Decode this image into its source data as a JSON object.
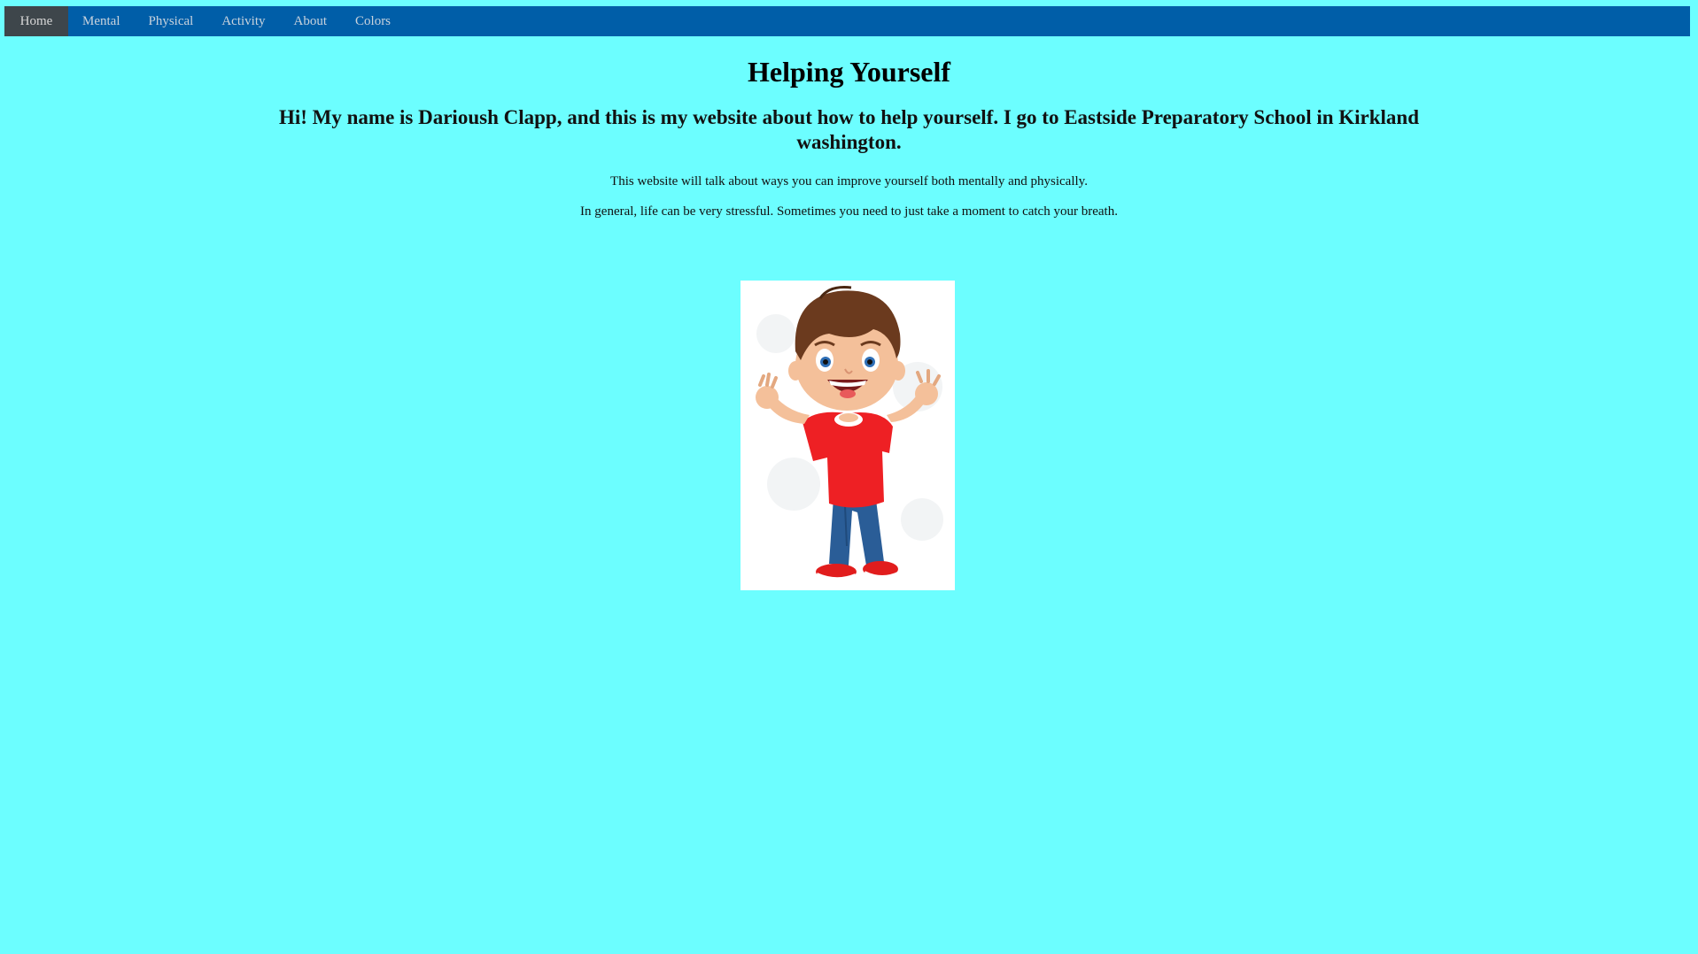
{
  "nav": {
    "items": [
      {
        "label": "Home",
        "active": true
      },
      {
        "label": "Mental",
        "active": false
      },
      {
        "label": "Physical",
        "active": false
      },
      {
        "label": "Activity",
        "active": false
      },
      {
        "label": "About",
        "active": false
      },
      {
        "label": "Colors",
        "active": false
      }
    ]
  },
  "main": {
    "title": "Helping Yourself",
    "intro": "Hi! My name is Darioush Clapp, and this is my website about how to help yourself. I go to Eastside Preparatory School in Kirkland washington.",
    "paragraphs": [
      "This website will talk about ways you can improve yourself both mentally and physically.",
      "In general, life can be very stressful. Sometimes you need to just take a moment to catch your breath."
    ],
    "image": {
      "subject": "cartoon-boy-waving"
    }
  },
  "colors": {
    "page_background": "#6cfeff",
    "navbar_background": "#005ea8",
    "nav_active_background": "#3e464b",
    "nav_text": "#c9d3dd"
  }
}
